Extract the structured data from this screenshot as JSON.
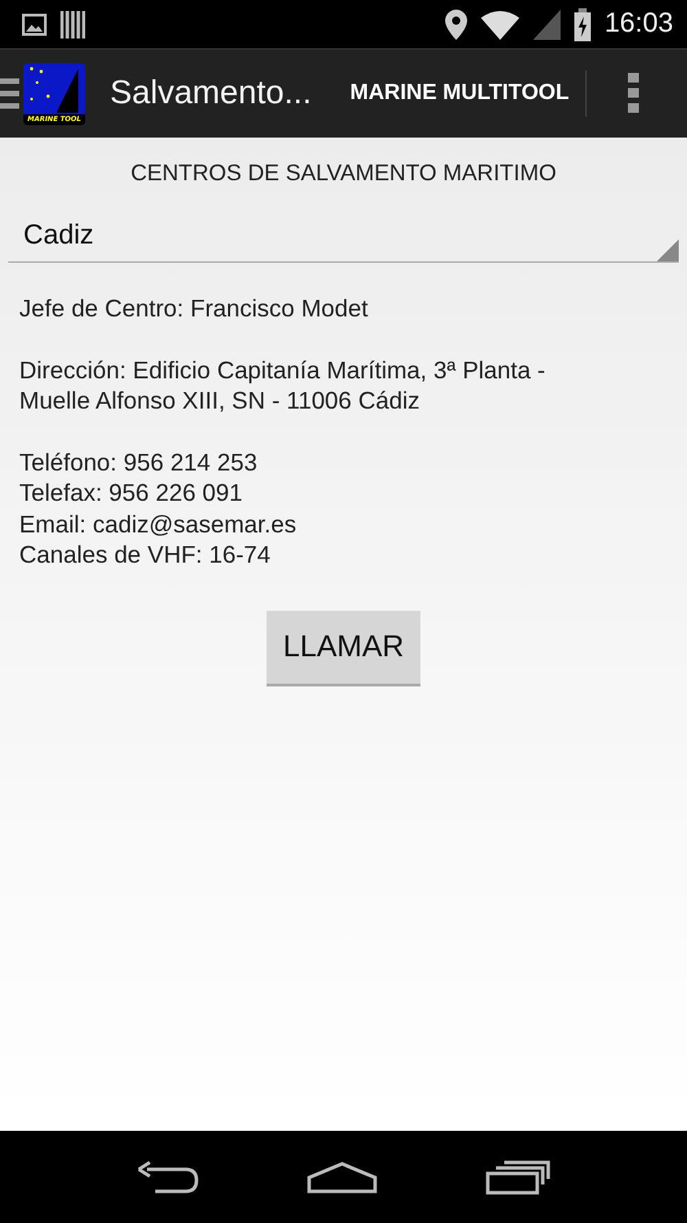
{
  "status_bar": {
    "time": "16:03"
  },
  "app_bar": {
    "logo_text": "MARINE TOOL",
    "title": "Salvamento...",
    "action": "MARINE MULTITOOL"
  },
  "heading": "CENTROS DE SALVAMENTO MARITIMO",
  "spinner": {
    "value": "Cadiz"
  },
  "details": [
    {
      "text": "Jefe de Centro: Francisco Modet"
    },
    {
      "text": "Dirección: Edificio Capitanía Marítima, 3ª Planta - Muelle Alfonso XIII, SN - 11006 Cádiz"
    },
    {
      "text": "Teléfono: 956 214 253"
    },
    {
      "text": "Telefax: 956 226 091"
    },
    {
      "text": "Email: cadiz@sasemar.es"
    },
    {
      "text": "Canales de VHF: 16-74"
    }
  ],
  "button": "LLAMAR"
}
